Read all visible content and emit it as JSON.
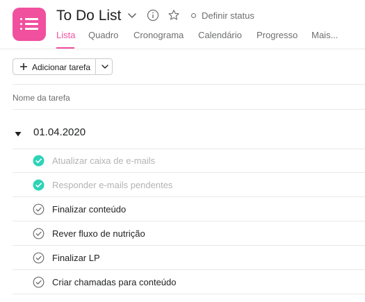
{
  "header": {
    "project_icon": "list-icon",
    "project_color": "#f0509e",
    "title": "To Do List",
    "status_label": "Definir status",
    "tabs": [
      {
        "label": "Lista",
        "active": true
      },
      {
        "label": "Quadro",
        "active": false
      },
      {
        "label": "Cronograma",
        "active": false
      },
      {
        "label": "Calendário",
        "active": false
      },
      {
        "label": "Progresso",
        "active": false
      },
      {
        "label": "Mais...",
        "active": false
      }
    ]
  },
  "toolbar": {
    "add_task_label": "Adicionar tarefa"
  },
  "columns": {
    "task_name": "Nome da tarefa"
  },
  "section": {
    "title": "01.04.2020",
    "tasks": [
      {
        "name": "Atualizar caixa de e-mails",
        "completed": true
      },
      {
        "name": "Responder e-mails pendentes",
        "completed": true
      },
      {
        "name": "Finalizar conteúdo",
        "completed": false
      },
      {
        "name": "Rever fluxo de nutrição",
        "completed": false
      },
      {
        "name": "Finalizar LP",
        "completed": false
      },
      {
        "name": "Criar chamadas para conteúdo",
        "completed": false
      }
    ]
  },
  "colors": {
    "accent": "#f0509e",
    "completed_check": "#2ed3b7",
    "text": "#1e1f21",
    "muted_text": "#6d6e6f",
    "completed_text": "#b3b3b3"
  }
}
